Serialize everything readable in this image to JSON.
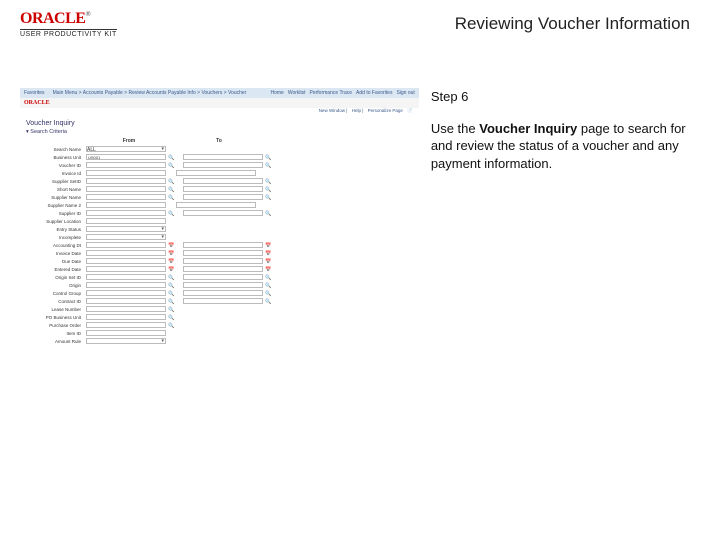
{
  "header": {
    "brand": "ORACLE",
    "product": "USER PRODUCTIVITY KIT",
    "page_title": "Reviewing Voucher Information"
  },
  "instruction": {
    "step": "Step 6",
    "text_prefix": "Use the ",
    "text_bold": "Voucher Inquiry",
    "text_suffix": " page to search for and review the status of a voucher and any payment information."
  },
  "screenshot": {
    "topbar": {
      "crumbs": [
        "Favorites",
        "Main Menu",
        "Accounts Payable",
        "Review Accounts Payable Info",
        "Vouchers",
        "Voucher"
      ],
      "right": [
        "Home",
        "Worklist",
        "Performance Trace",
        "Add to Favorites",
        "Sign out"
      ]
    },
    "brand": "ORACLE",
    "subbar": [
      "New Window",
      "Help",
      "Personalize Page"
    ],
    "page_title": "Voucher Inquiry",
    "search_section": "Search Criteria",
    "columns": {
      "from": "From",
      "to": "To"
    },
    "rows": [
      {
        "label": "Search Name",
        "type": "select",
        "value": "ALL"
      },
      {
        "label": "Business Unit",
        "type": "lookup",
        "value": "US001",
        "to_lookup": true
      },
      {
        "label": "Voucher ID",
        "type": "lookup",
        "to_lookup": true
      },
      {
        "label": "Invoice Id",
        "type": "text",
        "to_text": true
      },
      {
        "label": "Supplier SetID",
        "type": "lookup",
        "to_lookup": true
      },
      {
        "label": "Short Name",
        "type": "lookup",
        "to_lookup": true
      },
      {
        "label": "Supplier Name",
        "type": "lookup",
        "to_lookup": true
      },
      {
        "label": "Supplier Name 2",
        "type": "text",
        "to_text": true
      },
      {
        "label": "Supplier ID",
        "type": "lookup",
        "to_lookup": true
      },
      {
        "label": "Supplier Location",
        "type": "text"
      },
      {
        "label": "Entry Status",
        "type": "select"
      },
      {
        "label": "Incomplete",
        "type": "select"
      },
      {
        "label": "Accounting Dt",
        "type": "date",
        "to_date": true
      },
      {
        "label": "Invoice Date",
        "type": "date",
        "to_date": true
      },
      {
        "label": "Due Date",
        "type": "date",
        "to_date": true
      },
      {
        "label": "Entered Date",
        "type": "date",
        "to_date": true
      },
      {
        "label": "Origin Set ID",
        "type": "lookup",
        "to_lookup": true
      },
      {
        "label": "Origin",
        "type": "lookup",
        "to_lookup": true
      },
      {
        "label": "Control Group",
        "type": "lookup",
        "to_lookup": true
      },
      {
        "label": "Contract ID",
        "type": "lookup",
        "to_lookup": true
      },
      {
        "label": "Lease Number",
        "type": "lookup"
      },
      {
        "label": "PO Business Unit",
        "type": "lookup"
      },
      {
        "label": "Purchase Order",
        "type": "lookup"
      },
      {
        "label": "Item ID",
        "type": "text"
      },
      {
        "label": "Amount Rule",
        "type": "select"
      }
    ]
  }
}
